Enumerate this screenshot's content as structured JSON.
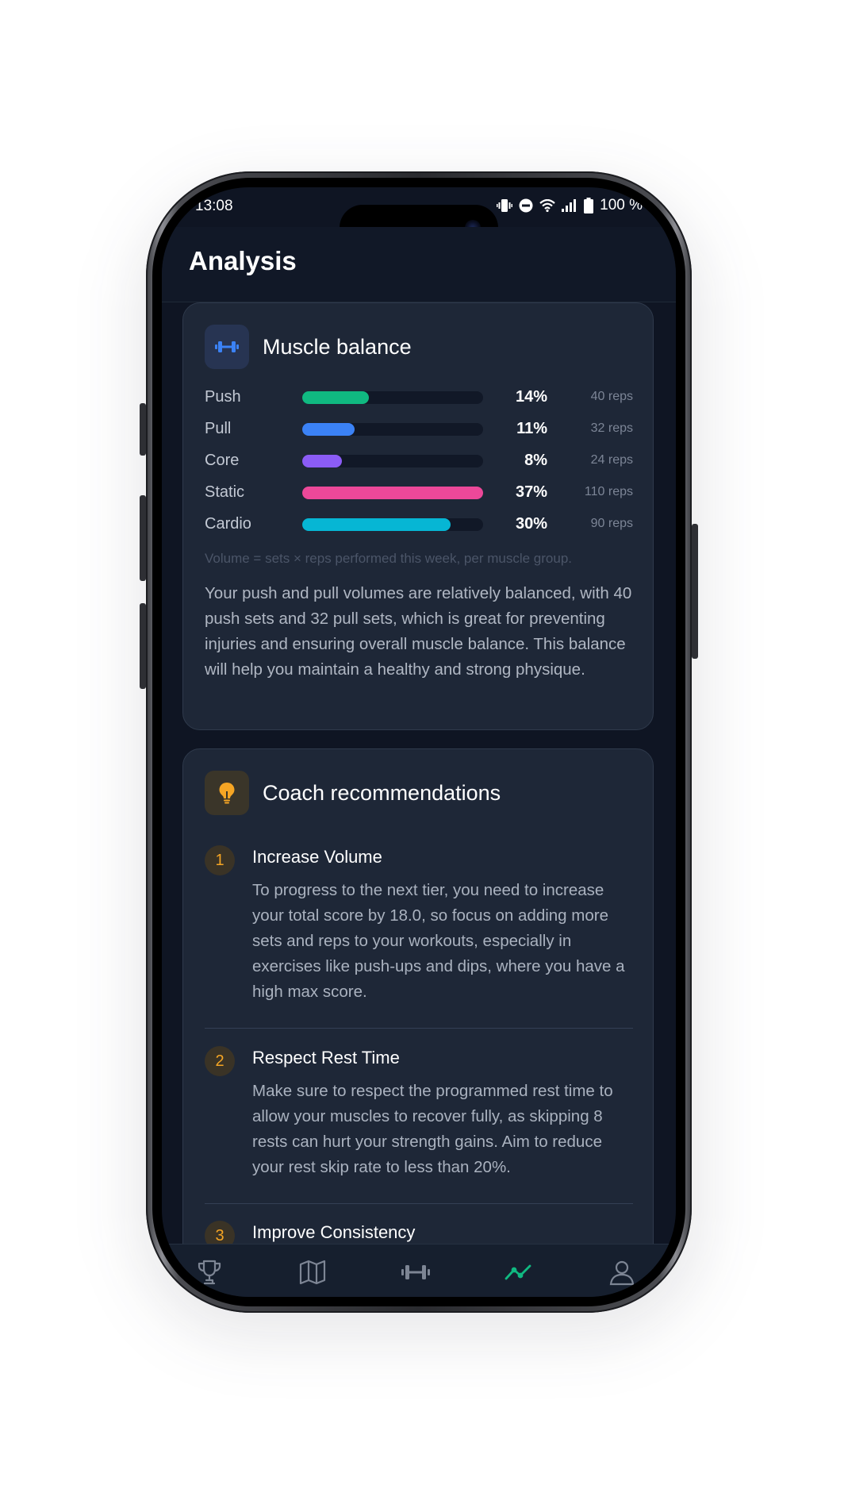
{
  "status_bar": {
    "time": "13:08",
    "battery": "100 %",
    "icons": [
      "vibrate-icon",
      "do-not-disturb-icon",
      "wifi-icon",
      "signal-icon",
      "battery-icon"
    ]
  },
  "header": {
    "title": "Analysis"
  },
  "muscle_balance": {
    "title": "Muscle balance",
    "icon": "dumbbell-icon",
    "rows": [
      {
        "label": "Push",
        "percent": "14%",
        "reps": "40 reps",
        "fraction": 0.37,
        "color": "#10b981"
      },
      {
        "label": "Pull",
        "percent": "11%",
        "reps": "32 reps",
        "fraction": 0.29,
        "color": "#3b82f6"
      },
      {
        "label": "Core",
        "percent": "8%",
        "reps": "24 reps",
        "fraction": 0.22,
        "color": "#8b5cf6"
      },
      {
        "label": "Static",
        "percent": "37%",
        "reps": "110 reps",
        "fraction": 1.0,
        "color": "#ec4899"
      },
      {
        "label": "Cardio",
        "percent": "30%",
        "reps": "90 reps",
        "fraction": 0.82,
        "color": "#06b6d4"
      }
    ],
    "note": "Volume = sets × reps performed this week, per muscle group.",
    "summary": "Your push and pull volumes are relatively balanced, with 40 push sets and 32 pull sets, which is great for preventing injuries and ensuring overall muscle balance. This balance will help you maintain a healthy and strong physique."
  },
  "coach": {
    "title": "Coach recommendations",
    "icon": "lightbulb-icon",
    "items": [
      {
        "number": "1",
        "title": "Increase Volume",
        "text": "To progress to the next tier, you need to increase your total score by 18.0, so focus on adding more sets and reps to your workouts, especially in exercises like push-ups and dips, where you have a high max score."
      },
      {
        "number": "2",
        "title": "Respect Rest Time",
        "text": "Make sure to respect the programmed rest time to allow your muscles to recover fully, as skipping 8 rests can hurt your strength gains. Aim to reduce your rest skip rate to less than 20%."
      },
      {
        "number": "3",
        "title": "Improve Consistency",
        "text": ""
      }
    ]
  },
  "tabbar": {
    "tabs": [
      {
        "name": "trophy",
        "icon": "trophy-icon",
        "label": "",
        "active": false
      },
      {
        "name": "map",
        "icon": "map-icon",
        "label": "",
        "active": false
      },
      {
        "name": "workout",
        "icon": "dumbbell-icon",
        "label": "",
        "active": false
      },
      {
        "name": "analysis",
        "icon": "trend-icon",
        "label": "",
        "active": true
      },
      {
        "name": "profile",
        "icon": "user-icon",
        "label": "",
        "active": false
      }
    ]
  }
}
